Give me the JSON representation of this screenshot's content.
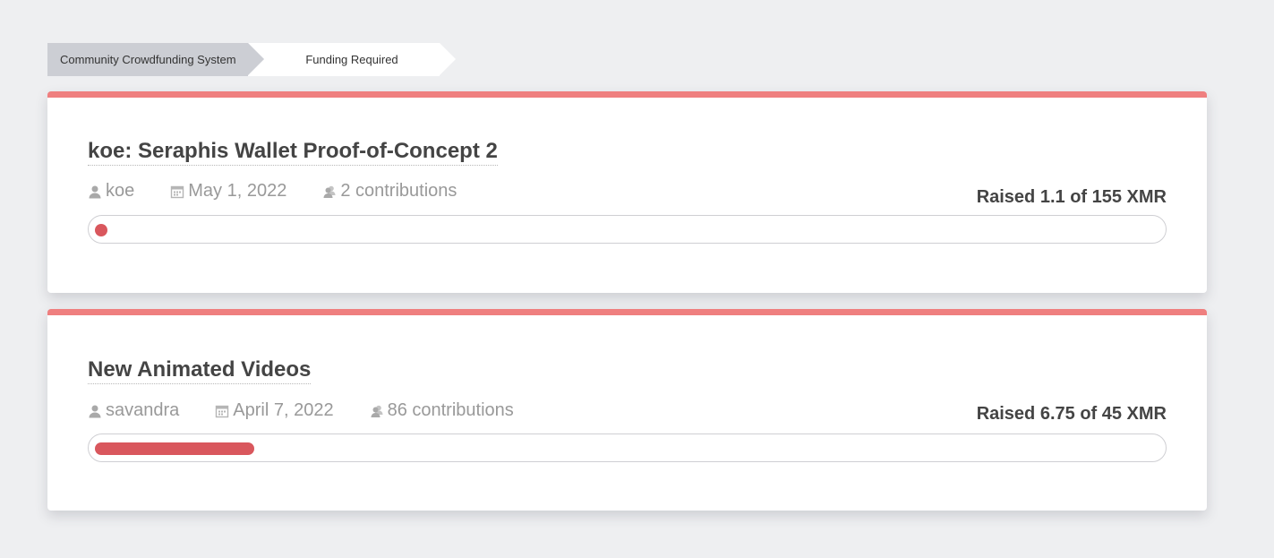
{
  "breadcrumb": {
    "items": [
      "Community Crowdfunding System",
      "Funding Required"
    ]
  },
  "accent_color": "#ef7f7f",
  "progress_color": "#d9575d",
  "proposals": [
    {
      "title": "koe: Seraphis Wallet Proof-of-Concept 2",
      "author": "koe",
      "date": "May 1, 2022",
      "contributions": "2 contributions",
      "raised_text": "Raised 1.1 of 155 XMR",
      "raised": 1.1,
      "goal": 155,
      "author_icon": "user-icon",
      "date_icon": "calendar-icon",
      "contributions_icon": "users-icon"
    },
    {
      "title": "New Animated Videos",
      "author": "savandra",
      "date": "April 7, 2022",
      "contributions": "86 contributions",
      "raised_text": "Raised 6.75 of 45 XMR",
      "raised": 6.75,
      "goal": 45,
      "author_icon": "user-icon",
      "date_icon": "calendar-icon",
      "contributions_icon": "users-icon"
    }
  ]
}
